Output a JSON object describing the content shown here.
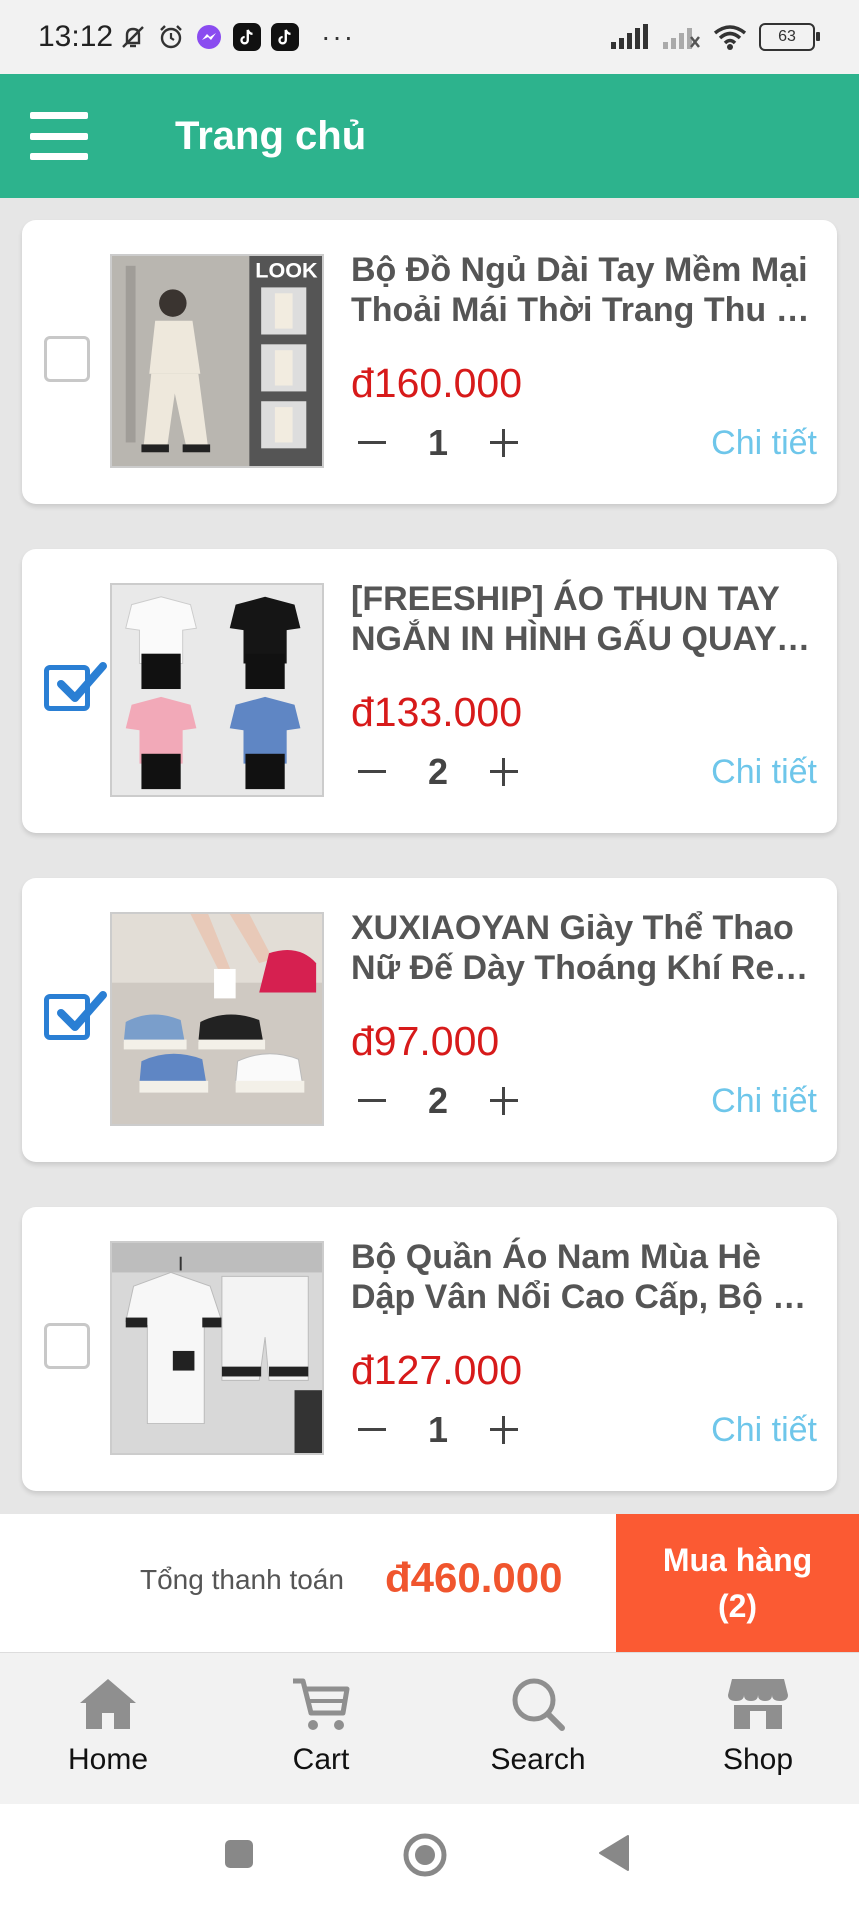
{
  "status_bar": {
    "time": "13:12",
    "battery": "63",
    "icons": [
      "mute-bell-icon",
      "alarm-icon",
      "messenger-icon",
      "tiktok-icon",
      "tiktok-icon",
      "more-dots-icon",
      "signal-icon",
      "signal-off-icon",
      "wifi-icon",
      "battery-icon"
    ],
    "more": "···"
  },
  "header": {
    "title": "Trang chủ",
    "menu_icon": "hamburger-menu-icon",
    "background": "#2db38d"
  },
  "cart": {
    "items": [
      {
        "name_line1": "Bộ Đồ Ngủ Dài Tay Mềm Mại",
        "name_line2": "Thoải Mái Thời Trang Thu Đ...",
        "price": "đ160.000",
        "quantity": "1",
        "checked": false,
        "detail": "Chi tiết"
      },
      {
        "name_line1": "[FREESHIP] ÁO THUN TAY",
        "name_line2": "NGẮN IN HÌNH GẤU QUAY L...",
        "price": "đ133.000",
        "quantity": "2",
        "checked": true,
        "detail": "Chi tiết"
      },
      {
        "name_line1": "XUXIAOYAN Giày Thể Thao",
        "name_line2": "Nữ Đế Dày Thoáng Khí Retr...",
        "price": "đ97.000",
        "quantity": "2",
        "checked": true,
        "detail": "Chi tiết"
      },
      {
        "name_line1": "Bộ Quần Áo Nam Mùa Hè",
        "name_line2": "Dập Vân Nổi Cao Cấp, Bộ Đ...",
        "price": "đ127.000",
        "quantity": "1",
        "checked": false,
        "detail": "Chi tiết"
      }
    ]
  },
  "checkout": {
    "total_label": "Tổng thanh toán",
    "total_value": "đ460.000",
    "buy_label": "Mua hàng",
    "buy_count": "(2)",
    "accent": "#fb5a33"
  },
  "bottom_nav": {
    "items": [
      {
        "label": "Home",
        "icon": "home-icon"
      },
      {
        "label": "Cart",
        "icon": "cart-icon"
      },
      {
        "label": "Search",
        "icon": "search-icon"
      },
      {
        "label": "Shop",
        "icon": "shop-icon"
      }
    ]
  },
  "system_nav": {
    "buttons": [
      "recents-square-icon",
      "home-circle-icon",
      "back-triangle-icon"
    ]
  }
}
